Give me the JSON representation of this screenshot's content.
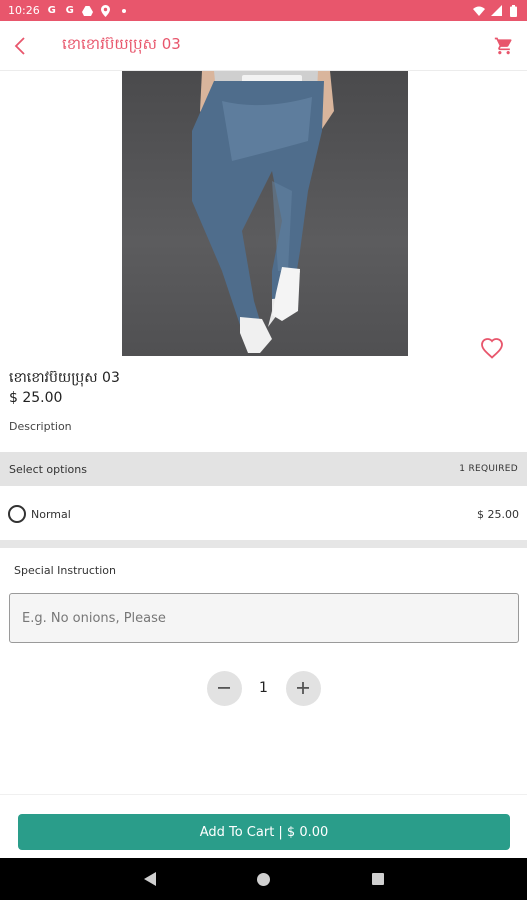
{
  "status_bar": {
    "time": "10:26",
    "notification_icons": [
      "google-g-icon",
      "google-g-icon",
      "drive-icon",
      "location-icon",
      "dot-icon"
    ],
    "system_icons": [
      "wifi-icon",
      "signal-icon",
      "battery-icon"
    ]
  },
  "app_bar": {
    "title": "ខោខោវប៊យប្រុស 03",
    "accent_color": "#e8566c"
  },
  "product": {
    "name": "ខោខោវប៊យប្រុស 03",
    "price": "$ 25.00",
    "description_label": "Description"
  },
  "options": {
    "title": "Select options",
    "required": "1 REQUIRED",
    "items": [
      {
        "label": "Normal",
        "price": "$ 25.00",
        "selected": false
      }
    ]
  },
  "special_instruction": {
    "label": "Special Instruction",
    "value": "",
    "placeholder": "E.g. No onions, Please"
  },
  "quantity": {
    "value": "1"
  },
  "add_to_cart": {
    "label": "Add To Cart | $ 0.00",
    "color": "#2a9d8a"
  }
}
